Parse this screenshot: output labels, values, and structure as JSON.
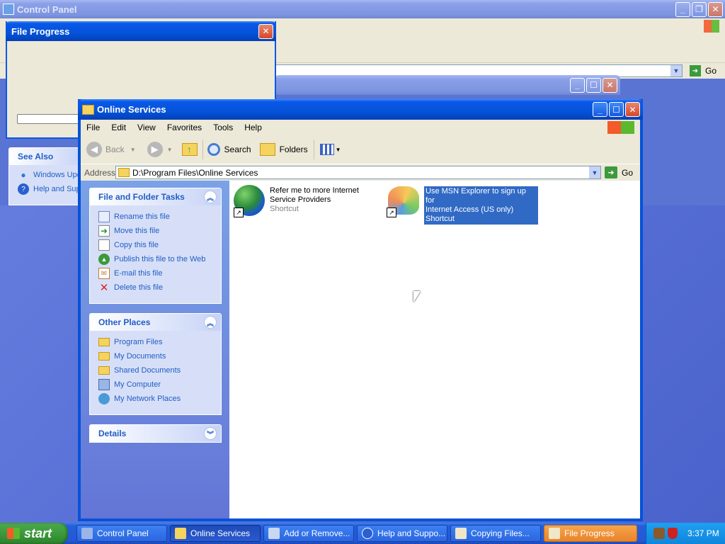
{
  "control_panel": {
    "title": "Control Panel",
    "address_go": "Go"
  },
  "see_also": {
    "header": "See Also",
    "items": [
      "Windows Upd",
      "Help and Sup"
    ]
  },
  "file_progress": {
    "title": "File Progress"
  },
  "add_remove_window": {
    "title": ""
  },
  "explorer": {
    "title": "Online Services",
    "menu": [
      "File",
      "Edit",
      "View",
      "Favorites",
      "Tools",
      "Help"
    ],
    "toolbar": {
      "back": "Back",
      "search": "Search",
      "folders": "Folders"
    },
    "address_label": "Address",
    "address_value": "D:\\Program Files\\Online Services",
    "go": "Go",
    "file_tasks": {
      "header": "File and Folder Tasks",
      "items": [
        "Rename this file",
        "Move this file",
        "Copy this file",
        "Publish this file to the Web",
        "E-mail this file",
        "Delete this file"
      ]
    },
    "other_places": {
      "header": "Other Places",
      "items": [
        "Program Files",
        "My Documents",
        "Shared Documents",
        "My Computer",
        "My Network Places"
      ]
    },
    "details": {
      "header": "Details"
    },
    "files": [
      {
        "name_line1": "Refer me to more Internet",
        "name_line2": "Service Providers",
        "type": "Shortcut",
        "selected": false
      },
      {
        "name_line1": "Use MSN Explorer to sign up for",
        "name_line2": "Internet Access (US only)",
        "type": "Shortcut",
        "selected": true
      }
    ]
  },
  "taskbar": {
    "start": "start",
    "buttons": [
      "Control Panel",
      "Online Services",
      "Add or Remove...",
      "Help and Suppo...",
      "Copying Files...",
      "File Progress"
    ],
    "clock": "3:37 PM"
  },
  "colors": {
    "title_blue": "#0553d8",
    "taskbar_blue": "#245edb",
    "start_green": "#3c9a3c",
    "selection": "#316ac5",
    "link_blue": "#215dc6"
  }
}
